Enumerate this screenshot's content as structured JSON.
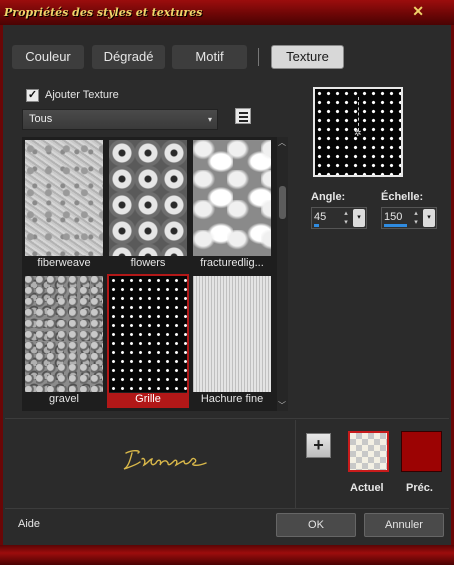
{
  "window": {
    "title": "Propriétés des styles et textures",
    "close_glyph": "✕"
  },
  "tabs": [
    {
      "label": "Couleur",
      "selected": false
    },
    {
      "label": "Dégradé",
      "selected": false
    },
    {
      "label": "Motif",
      "selected": false
    },
    {
      "label": "Texture",
      "selected": true
    }
  ],
  "add_texture": {
    "label": "Ajouter Texture",
    "checked": true,
    "check_glyph": "✓"
  },
  "category_select": {
    "value": "Tous",
    "arrow": "▾"
  },
  "textures": [
    {
      "name": "fiberweave",
      "selected": false
    },
    {
      "name": "flowers",
      "selected": false
    },
    {
      "name": "fracturedlig...",
      "selected": false
    },
    {
      "name": "gravel",
      "selected": false
    },
    {
      "name": "Grille",
      "selected": true
    },
    {
      "name": "Hachure fine",
      "selected": false
    }
  ],
  "scrollbar": {
    "up": "︿",
    "down": "﹀"
  },
  "preview": {
    "center_glyph": "✲"
  },
  "angle": {
    "label": "Angle:",
    "value": "45",
    "fraction": 0.125
  },
  "scale": {
    "label": "Échelle:",
    "value": "150",
    "fraction": 0.6
  },
  "spinner": {
    "up": "▴",
    "down": "▾",
    "dropdown": "▾"
  },
  "swatches": {
    "add_glyph": "+",
    "actuel_label": "Actuel",
    "prec_label": "Préc.",
    "prec_color": "#9c0303"
  },
  "signature": "Tiloune",
  "footer": {
    "help": "Aide",
    "ok": "OK",
    "cancel": "Annuler"
  },
  "colors": {
    "accent": "#b21818",
    "title_text": "#f0d36a",
    "progress": "#2f8be0"
  }
}
